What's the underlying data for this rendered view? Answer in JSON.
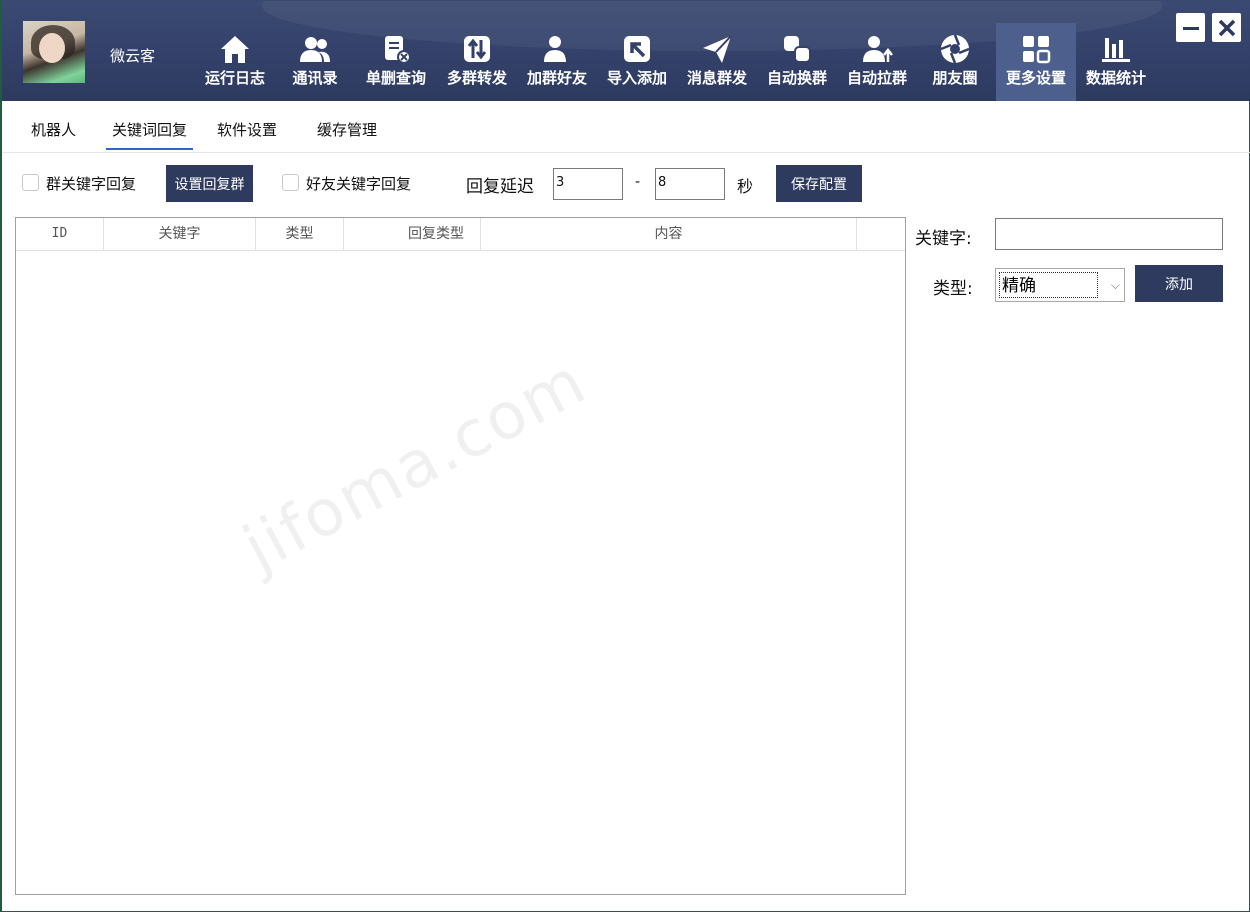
{
  "window": {
    "username": "微云客",
    "minimize_icon": "minimize-icon",
    "close_icon": "close-icon"
  },
  "nav": [
    {
      "label": "运行日志",
      "icon": "home-icon"
    },
    {
      "label": "通讯录",
      "icon": "contacts-icon"
    },
    {
      "label": "单删查询",
      "icon": "delete-check-icon"
    },
    {
      "label": "多群转发",
      "icon": "forward-icon"
    },
    {
      "label": "加群好友",
      "icon": "add-friend-icon"
    },
    {
      "label": "导入添加",
      "icon": "import-icon"
    },
    {
      "label": "消息群发",
      "icon": "send-icon"
    },
    {
      "label": "自动换群",
      "icon": "switch-group-icon"
    },
    {
      "label": "自动拉群",
      "icon": "pull-group-icon"
    },
    {
      "label": "朋友圈",
      "icon": "aperture-icon"
    },
    {
      "label": "更多设置",
      "icon": "grid-icon",
      "active": true
    },
    {
      "label": "数据统计",
      "icon": "bar-chart-icon"
    }
  ],
  "tabs": [
    {
      "label": "机器人"
    },
    {
      "label": "关键词回复",
      "active": true
    },
    {
      "label": "软件设置"
    },
    {
      "label": "缓存管理"
    }
  ],
  "toolbar": {
    "group_keyword_reply_label": "群关键字回复",
    "set_reply_group_button": "设置回复群",
    "friend_keyword_reply_label": "好友关键字回复",
    "reply_delay_label": "回复延迟",
    "delay_min": "3",
    "delay_separator": "-",
    "delay_max": "8",
    "seconds_label": "秒",
    "save_config_button": "保存配置"
  },
  "table": {
    "columns": [
      "ID",
      "关键字",
      "类型",
      "回复类型",
      "内容"
    ],
    "rows": []
  },
  "form": {
    "keyword_label": "关键字:",
    "keyword_value": "",
    "type_label": "类型:",
    "type_value": "精确",
    "add_button": "添加"
  },
  "watermark": "jifoma.com",
  "colors": {
    "header_bg": "#33416a",
    "button_bg": "#2e3b5f",
    "active_tab_underline": "#2b66c8"
  }
}
